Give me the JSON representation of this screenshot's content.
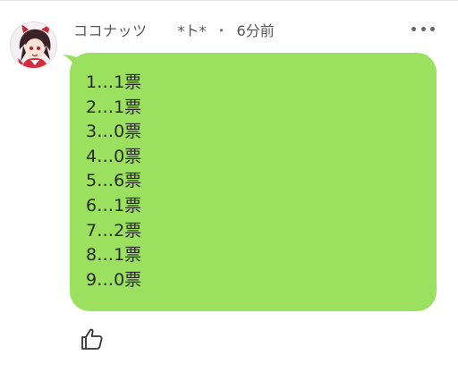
{
  "post": {
    "author": "ココナッツ",
    "meta_tag": "*ト*",
    "separator": "・",
    "time": "6分前",
    "lines": [
      "1…1票",
      "2…1票",
      "3…0票",
      "4…0票",
      "5…6票",
      "6…1票",
      "7…2票",
      "8…1票",
      "9…0票"
    ]
  },
  "colors": {
    "bubble": "#9be05f",
    "text": "#2a2a2a",
    "meta": "#555555"
  },
  "icons": {
    "menu": "more-dots-icon",
    "like": "thumbs-up-icon",
    "avatar": "avatar-anime-character"
  }
}
